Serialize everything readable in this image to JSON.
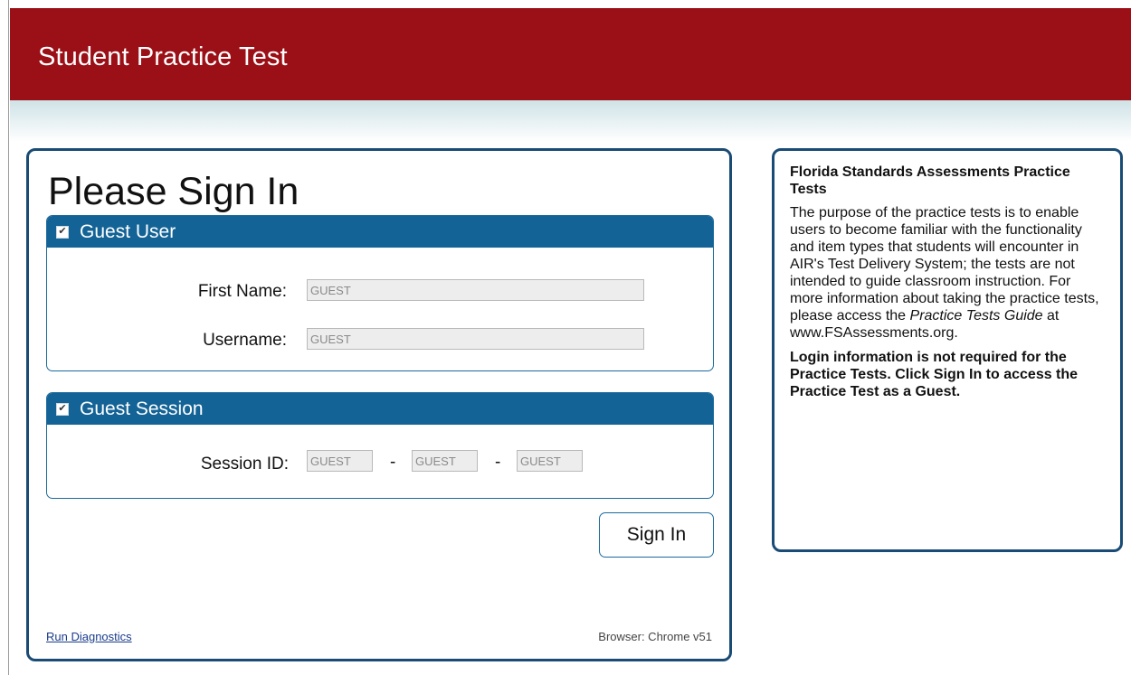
{
  "header": {
    "title": "Student Practice Test"
  },
  "login": {
    "title": "Please Sign In",
    "guest_user": {
      "label": "Guest User",
      "checked": true,
      "first_name_label": "First Name:",
      "first_name_value": "GUEST",
      "username_label": "Username:",
      "username_value": "GUEST"
    },
    "guest_session": {
      "label": "Guest Session",
      "checked": true,
      "session_id_label": "Session ID:",
      "separator": "-",
      "session_id_values": [
        "GUEST",
        "GUEST",
        "GUEST"
      ]
    },
    "sign_in_label": "Sign In",
    "run_diagnostics": "Run Diagnostics",
    "browser_info": "Browser: Chrome v51"
  },
  "info": {
    "title": "Florida Standards Assessments Practice Tests",
    "body_before": "The purpose of the practice tests is to enable users to become familiar with the functionality and item types that students will encounter in AIR's Test Delivery System; the tests are not intended to guide classroom instruction. For more information about taking the practice tests, please access the ",
    "body_italic": "Practice Tests Guide",
    "body_after": " at www.FSAssessments.org.",
    "bold_note": "Login information is not required for the Practice Tests. Click Sign In to access the Practice Test as a Guest."
  },
  "colors": {
    "header_bg": "#9b0f16",
    "section_head_bg": "#146396",
    "card_border": "#1a4b75"
  },
  "icons": {
    "checkbox": "checkbox-checked-icon"
  }
}
